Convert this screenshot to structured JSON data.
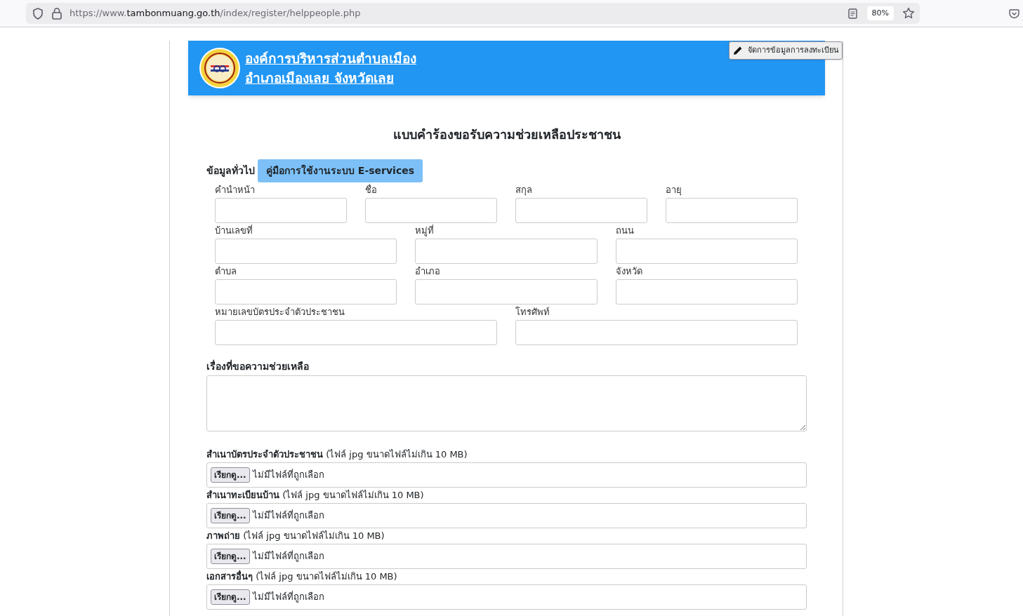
{
  "browser": {
    "url": {
      "prefix": "https://www.",
      "host": "tambonmuang.go.th",
      "path": "/index/register/helppeople.php"
    },
    "zoom": "80%"
  },
  "manage_button": "จัดการข้อมูลการลงทะเบียน",
  "header": {
    "lines": [
      "องค์การบริหารส่วนตำบลเมือง",
      "อำเภอเมืองเลย จังหวัดเลย"
    ]
  },
  "form": {
    "title": "แบบคำร้องขอรับความช่วยเหลือประชาชน",
    "section": "ข้อมูลทั่วไป",
    "manual_button": "คู่มือการใช้งานระบบ E-services",
    "rows": [
      {
        "fields": [
          {
            "label": "คำนำหน้า"
          },
          {
            "label": "ชื่อ"
          },
          {
            "label": "สกุล"
          },
          {
            "label": "อายุ"
          }
        ]
      },
      {
        "fields": [
          {
            "label": "บ้านเลขที่"
          },
          {
            "label": "หมู่ที่"
          },
          {
            "label": "ถนน"
          }
        ]
      },
      {
        "fields": [
          {
            "label": "ตำบล"
          },
          {
            "label": "อำเภอ"
          },
          {
            "label": "จังหวัด"
          }
        ]
      },
      {
        "fields": [
          {
            "label": "หมายเลขบัตรประจำตัวประชาชน"
          },
          {
            "label": "โทรศัพท์"
          }
        ]
      }
    ],
    "request_label": "เรื่องที่ขอความช่วยเหลือ",
    "uploads": [
      {
        "label": "**สำเนาบัตรประจำตัวประชาชน** (ไฟล์ jpg ขนาดไฟล์ไม่เกิน 10 MB)",
        "button": "เรียกดู...",
        "status": "ไม่มีไฟล์ที่ถูกเลือก"
      },
      {
        "label": "**สำเนาทะเบียนบ้าน** (ไฟล์ jpg ขนาดไฟล์ไม่เกิน 10 MB)",
        "button": "เรียกดู...",
        "status": "ไม่มีไฟล์ที่ถูกเลือก"
      },
      {
        "label": "**ภาพถ่าย** (ไฟล์ jpg ขนาดไฟล์ไม่เกิน 10 MB)",
        "button": "เรียกดู...",
        "status": "ไม่มีไฟล์ที่ถูกเลือก"
      },
      {
        "label": "**เอกสารอื่นๆ** (ไฟล์ jpg ขนาดไฟล์ไม่เกิน 10 MB)",
        "button": "เรียกดู...",
        "status": "ไม่มีไฟล์ที่ถูกเลือก"
      }
    ]
  }
}
